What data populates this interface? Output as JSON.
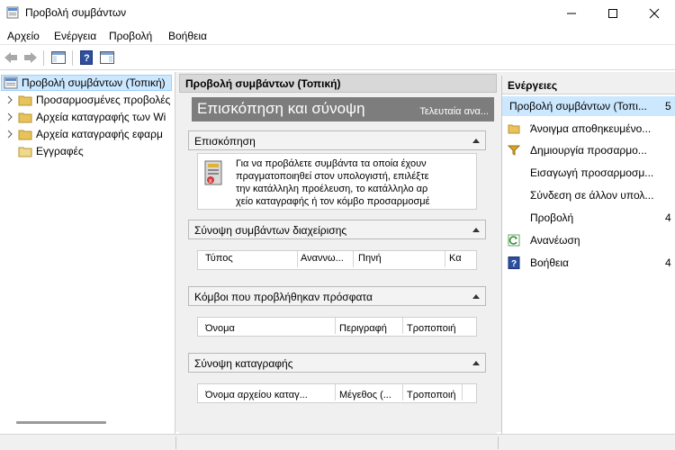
{
  "window": {
    "title": "Προβολή συμβάντων"
  },
  "menu": [
    "Αρχείο",
    "Ενέργεια",
    "Προβολή",
    "Βοήθεια"
  ],
  "tree": {
    "root": "Προβολή συμβάντων (Τοπική)",
    "items": [
      "Προσαρμοσμένες προβολές",
      "Αρχεία καταγραφής των Wi",
      "Αρχεία καταγραφής εφαρμ",
      "Εγγραφές"
    ]
  },
  "center": {
    "header": "Προβολή συμβάντων (Τοπική)",
    "overview_title": "Επισκόπηση και σύνοψη",
    "overview_right": "Τελευταία ανα...",
    "sections": {
      "overview": {
        "title": "Επισκόπηση",
        "text": [
          "Για να προβάλετε συμβάντα τα οποία έχουν",
          "πραγματοποιηθεί στον υπολογιστή, επιλέξτε",
          "την κατάλληλη προέλευση, το κατάλληλο αρ",
          "χείο καταγραφής ή τον κόμβο προσαρμοσμέ"
        ]
      },
      "admin_summary": {
        "title": "Σύνοψη συμβάντων διαχείρισης",
        "columns": [
          "Τύπος",
          "Αναννω...",
          "Πηνή",
          "Κα"
        ]
      },
      "recent_nodes": {
        "title": "Κόμβοι που προβλήθηκαν πρόσφατα",
        "columns": [
          "Όνομα",
          "Περιγραφή",
          "Τροποποιή"
        ]
      },
      "log_summary": {
        "title": "Σύνοψη καταγραφής",
        "columns": [
          "Όνομα αρχείου καταγ...",
          "Μέγεθος (...",
          "Τροποποιή"
        ]
      }
    }
  },
  "actions": {
    "header": "Ενέργειες",
    "items": [
      {
        "label": "Προβολή συμβάντων (Τοπι...",
        "icon": "none",
        "arrow": "5"
      },
      {
        "label": "Άνοιγμα αποθηκευμένο...",
        "icon": "folder-icon",
        "arrow": ""
      },
      {
        "label": "Δημιουργία προσαρμο...",
        "icon": "filter-icon",
        "arrow": ""
      },
      {
        "label": "Εισαγωγή προσαρμοσμ...",
        "icon": "none",
        "arrow": ""
      },
      {
        "label": "Σύνδεση σε άλλον υπολ...",
        "icon": "none",
        "arrow": ""
      },
      {
        "label": "Προβολή",
        "icon": "none",
        "arrow": "4"
      },
      {
        "label": "Ανανέωση",
        "icon": "refresh-icon",
        "arrow": ""
      },
      {
        "label": "Βοήθεια",
        "icon": "help-icon",
        "arrow": "4"
      }
    ]
  }
}
